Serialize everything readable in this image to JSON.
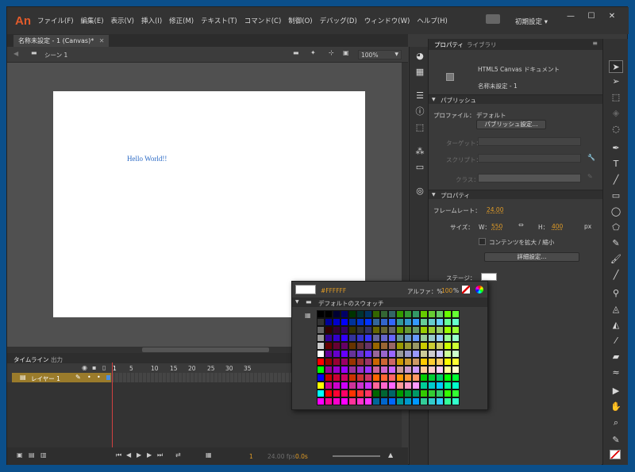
{
  "app": {
    "logo": "An"
  },
  "menu": [
    "ファイル(F)",
    "編集(E)",
    "表示(V)",
    "挿入(I)",
    "修正(M)",
    "テキスト(T)",
    "コマンド(C)",
    "制御(O)",
    "デバッグ(D)",
    "ウィンドウ(W)",
    "ヘルプ(H)"
  ],
  "workspace": {
    "label": "初期設定"
  },
  "window_controls": {
    "minimize": "—",
    "maximize": "☐",
    "close": "✕"
  },
  "document": {
    "tab": "名称未設定 - 1 (Canvas)*",
    "tab_close": "✕",
    "scene": "シーン 1",
    "zoom": "100%"
  },
  "stage": {
    "text": "Hello World!!",
    "background": "#FFFFFF"
  },
  "timeline": {
    "tabs": [
      "タイムライン",
      "出力"
    ],
    "frame_numbers": [
      "1",
      "5",
      "10",
      "15",
      "20",
      "25",
      "30",
      "35"
    ],
    "layer_name": "レイヤー 1",
    "current_frame": "1",
    "fps_readout": "24.00 fps",
    "time_readout": "0.0s"
  },
  "properties": {
    "tabs": [
      "プロパティ",
      "ライブラリ"
    ],
    "doc_type": "HTML5 Canvas ドキュメント",
    "doc_name": "名称未設定 - 1",
    "publish_section": "パブリッシュ",
    "profile_label": "プロファイル：",
    "profile_value": "デフォルト",
    "publish_settings_button": "パブリッシュ設定...",
    "target_label": "ターゲット：",
    "script_label": "スクリプト：",
    "class_label": "クラス：",
    "props_section": "プロパティ",
    "framerate_label": "フレームレート：",
    "framerate_value": "24.00",
    "size_label": "サイズ：",
    "w_label": "W：",
    "w_value": "550",
    "h_label": "H：",
    "h_value": "400",
    "unit": "px",
    "scale_checkbox": "コンテンツを拡大 / 縮小",
    "advanced_button": "詳細設定...",
    "stage_label": "ステージ："
  },
  "swatch_popup": {
    "hex": "#FFFFFF",
    "alpha_label": "アルファ：%",
    "alpha_value": "100",
    "alpha_unit": "%",
    "folder": "デフォルトのスウォッチ"
  },
  "colors": {
    "accent_orange": "#E09B26",
    "layer_bar": "#9A7B2B",
    "playhead": "#D04040",
    "link_blue": "#2A69C5"
  }
}
